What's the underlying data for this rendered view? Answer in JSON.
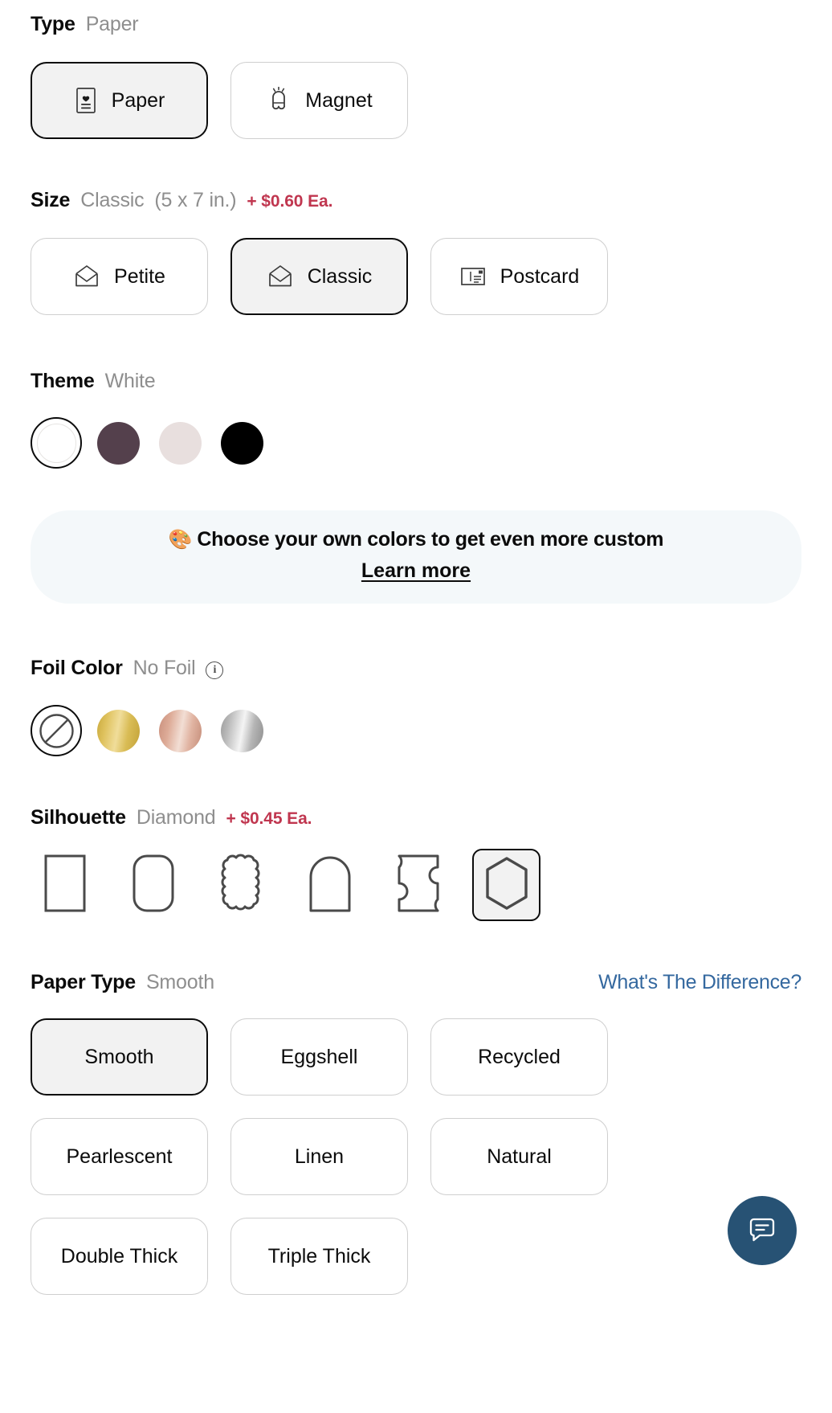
{
  "sections": {
    "type": {
      "title": "Type",
      "value": "Paper",
      "options": [
        {
          "label": "Paper",
          "icon": "card-heart-icon",
          "selected": true
        },
        {
          "label": "Magnet",
          "icon": "magnet-icon",
          "selected": false
        }
      ]
    },
    "size": {
      "title": "Size",
      "value": "Classic",
      "dimensions": "(5 x 7 in.)",
      "price": "+ $0.60 Ea.",
      "options": [
        {
          "label": "Petite",
          "icon": "envelope-icon",
          "selected": false
        },
        {
          "label": "Classic",
          "icon": "envelope-icon",
          "selected": true
        },
        {
          "label": "Postcard",
          "icon": "postcard-icon",
          "selected": false
        }
      ]
    },
    "theme": {
      "title": "Theme",
      "value": "White",
      "swatches": [
        {
          "name": "White",
          "color": "#ffffff",
          "selected": true
        },
        {
          "name": "Plum",
          "color": "#54404c",
          "selected": false
        },
        {
          "name": "Blush",
          "color": "#e8dfde",
          "selected": false
        },
        {
          "name": "Black",
          "color": "#000000",
          "selected": false
        }
      ]
    },
    "custom_banner": {
      "emoji": "🎨",
      "text": "Choose your own colors to get even more custom",
      "link": "Learn more"
    },
    "foil": {
      "title": "Foil Color",
      "value": "No Foil",
      "info_icon": "info-icon",
      "swatches": [
        {
          "name": "No Foil",
          "style": "none",
          "selected": true
        },
        {
          "name": "Gold",
          "style": "gold",
          "selected": false
        },
        {
          "name": "Rose Gold",
          "style": "rose",
          "selected": false
        },
        {
          "name": "Silver",
          "style": "silver",
          "selected": false
        }
      ]
    },
    "silhouette": {
      "title": "Silhouette",
      "value": "Diamond",
      "price": "+ $0.45 Ea.",
      "options": [
        {
          "name": "Square",
          "icon": "silhouette-square-icon",
          "selected": false
        },
        {
          "name": "Rounded",
          "icon": "silhouette-rounded-icon",
          "selected": false
        },
        {
          "name": "Scalloped",
          "icon": "silhouette-scalloped-icon",
          "selected": false
        },
        {
          "name": "Arch",
          "icon": "silhouette-arch-icon",
          "selected": false
        },
        {
          "name": "Ticket",
          "icon": "silhouette-ticket-icon",
          "selected": false
        },
        {
          "name": "Diamond",
          "icon": "silhouette-diamond-icon",
          "selected": true
        }
      ]
    },
    "paper_type": {
      "title": "Paper Type",
      "value": "Smooth",
      "help_link": "What's The Difference?",
      "options": [
        {
          "label": "Smooth",
          "selected": true
        },
        {
          "label": "Eggshell",
          "selected": false
        },
        {
          "label": "Recycled",
          "selected": false
        },
        {
          "label": "Pearlescent",
          "selected": false
        },
        {
          "label": "Linen",
          "selected": false
        },
        {
          "label": "Natural",
          "selected": false
        },
        {
          "label": "Double Thick",
          "selected": false
        },
        {
          "label": "Triple Thick",
          "selected": false
        }
      ]
    }
  },
  "chat": {
    "icon": "chat-bubble-icon",
    "color": "#275274"
  },
  "colors": {
    "accent_price": "#c0364f",
    "link_blue": "#34689f",
    "muted_text": "#8e8e8e",
    "selected_fill": "#f2f2f2",
    "banner_bg": "#f4f8fa"
  }
}
